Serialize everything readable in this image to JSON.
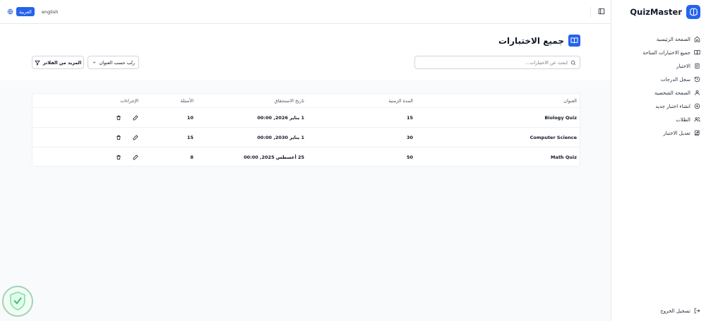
{
  "app": {
    "name": "QuizMaster"
  },
  "sidebar": {
    "items": [
      {
        "label": "الصفحة الرئيسية",
        "icon": "home-icon"
      },
      {
        "label": "جميع الاختبارات المتاحة",
        "icon": "book-icon"
      },
      {
        "label": "الاختبار",
        "icon": "clipboard-icon"
      },
      {
        "label": "سجل الدرجات",
        "icon": "history-icon"
      },
      {
        "label": "الصفحة الشخصية",
        "icon": "user-icon"
      },
      {
        "label": "انشاء اختبار جديد",
        "icon": "plus-circle-icon"
      },
      {
        "label": "الطلاب",
        "icon": "users-icon"
      },
      {
        "label": "تعديل الاختبار",
        "icon": "edit-book-icon"
      }
    ],
    "logout_label": "تسجيل الخروج"
  },
  "topbar": {
    "lang_active": "العربية",
    "lang_other": "english"
  },
  "page": {
    "title": "جميع الاختبارات",
    "search_placeholder": "ابحث عن الاختبارات...",
    "sort_label": "رتّب حسب العنوان",
    "filters_label": "المزيد من الفلاتر"
  },
  "table": {
    "headers": {
      "title": "العنوان",
      "duration": "المدة الزمنية",
      "due": "تاريخ الاستحقاق",
      "questions": "الأسئلة",
      "actions": "الإجراءات"
    },
    "rows": [
      {
        "title": "Biology Quiz",
        "duration": "15",
        "due": "1 يناير 2026, 00:00",
        "questions": "10"
      },
      {
        "title": "Computer Science",
        "duration": "30",
        "due": "1 يناير 2030, 00:00",
        "questions": "15"
      },
      {
        "title": "Math Quiz",
        "duration": "50",
        "due": "25 أغسطس 2025, 00:00",
        "questions": "8"
      }
    ]
  },
  "colors": {
    "accent": "#2563eb",
    "content_bg": "#f9fafb",
    "border": "#e5e7eb"
  }
}
